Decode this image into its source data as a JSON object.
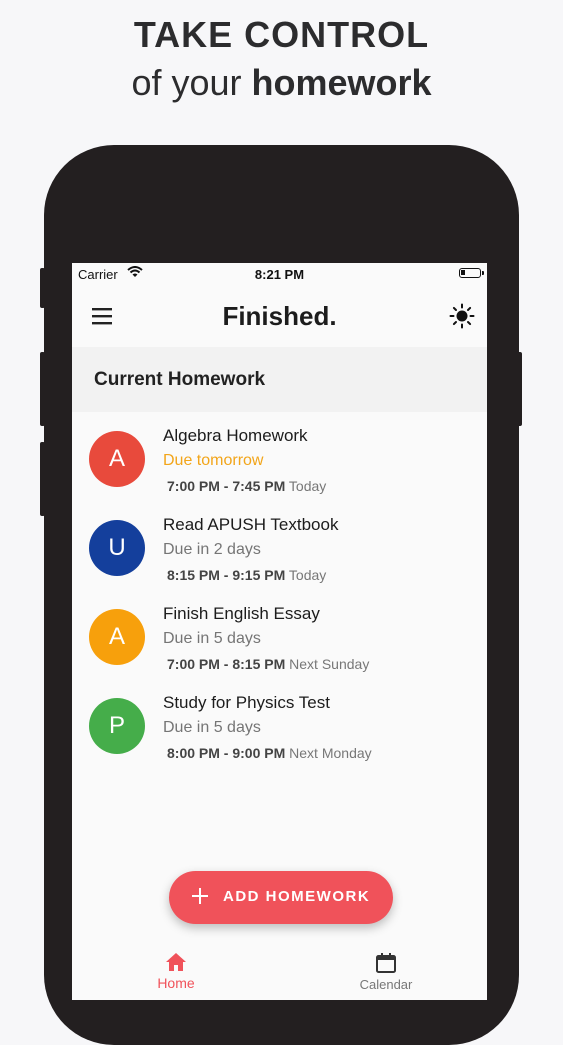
{
  "promo": {
    "headline": "TAKE CONTROL",
    "sub_light": "of your",
    "sub_bold": "homework"
  },
  "status_bar": {
    "carrier": "Carrier",
    "time": "8:21 PM"
  },
  "app_bar": {
    "title": "Finished.",
    "menu_icon": "hamburger-menu-icon",
    "theme_icon": "sun-icon"
  },
  "section": {
    "title": "Current Homework"
  },
  "homework": [
    {
      "initial": "A",
      "color": "#e84a3c",
      "title": "Algebra Homework",
      "due": "Due tomorrow",
      "urgent": true,
      "time_range": "7:00 PM - 7:45 PM",
      "day": "Today"
    },
    {
      "initial": "U",
      "color": "#143f9c",
      "title": "Read APUSH Textbook",
      "due": "Due in 2 days",
      "urgent": false,
      "time_range": "8:15 PM - 9:15 PM",
      "day": "Today"
    },
    {
      "initial": "A",
      "color": "#f7a00c",
      "title": "Finish English Essay",
      "due": "Due in 5 days",
      "urgent": false,
      "time_range": "7:00 PM - 8:15 PM",
      "day": "Next Sunday"
    },
    {
      "initial": "P",
      "color": "#45ad4a",
      "title": "Study for Physics Test",
      "due": "Due in 5 days",
      "urgent": false,
      "time_range": "8:00 PM - 9:00 PM",
      "day": "Next Monday"
    }
  ],
  "fab": {
    "label": "ADD HOMEWORK",
    "icon": "plus-icon",
    "color": "#f0525a"
  },
  "bottom_nav": {
    "home_label": "Home",
    "calendar_label": "Calendar",
    "active": "Home",
    "accent": "#f0525a"
  }
}
